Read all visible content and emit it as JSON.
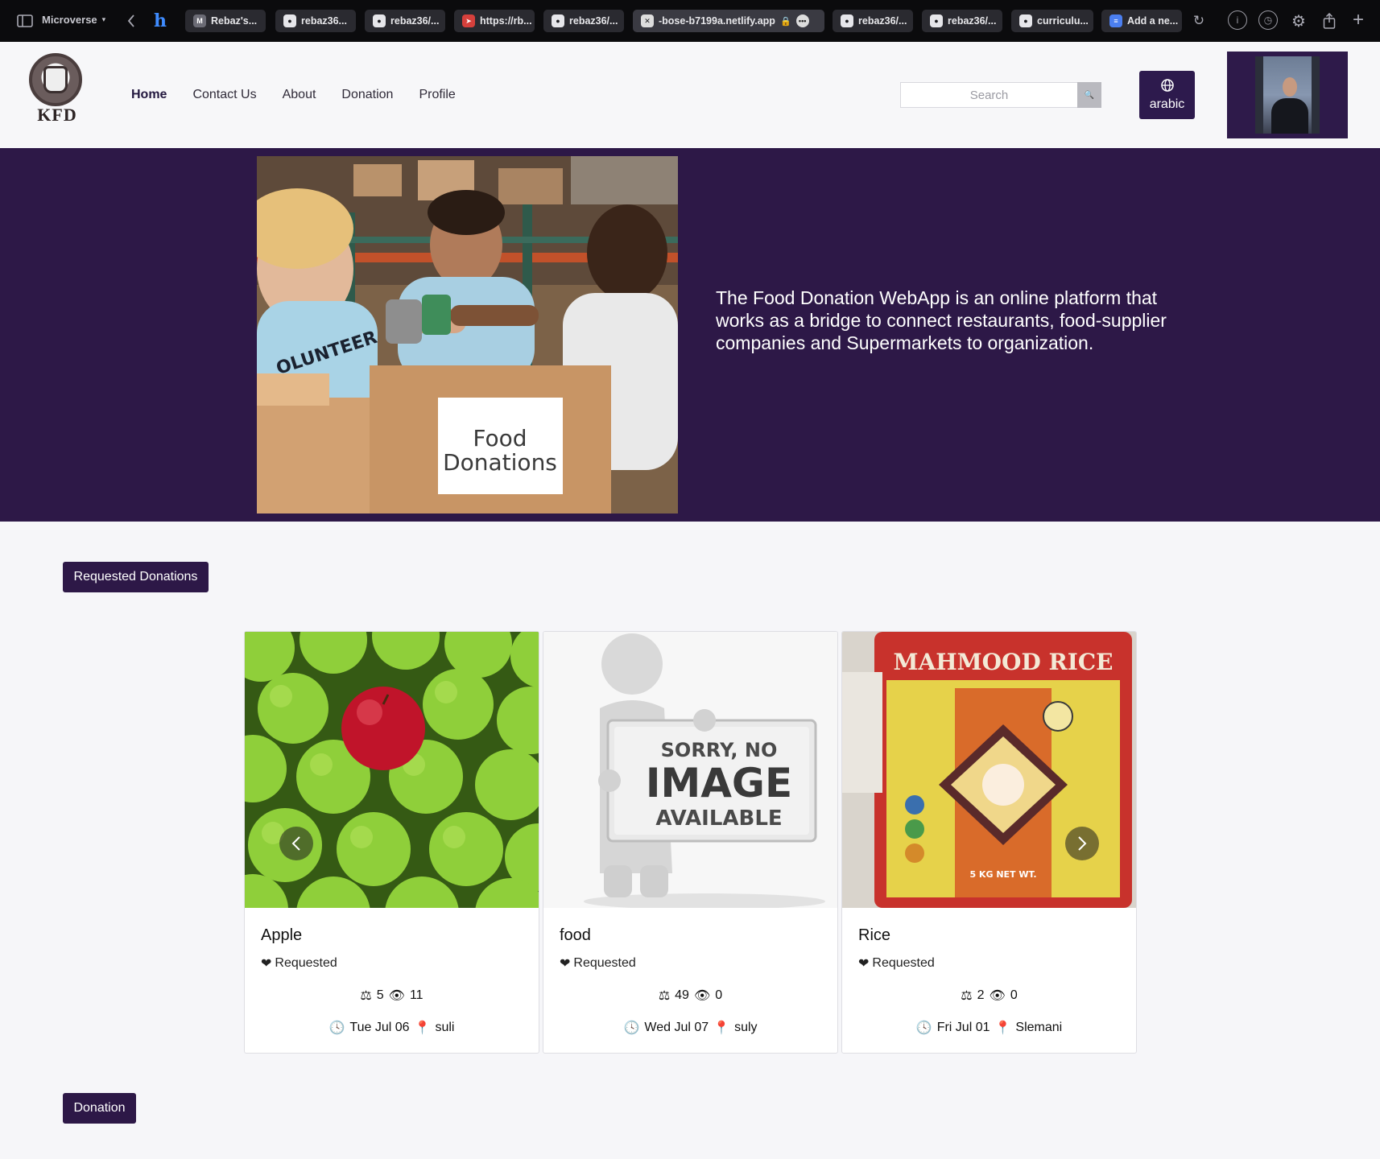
{
  "browser": {
    "workspace": "Microverse",
    "tabs": [
      {
        "label": "Rebaz's...",
        "favicon": "M"
      },
      {
        "label": "rebaz36...",
        "favicon": "github-icon"
      },
      {
        "label": "rebaz36/...",
        "favicon": "github-icon"
      },
      {
        "label": "https://rb...",
        "favicon": "rocket-icon"
      },
      {
        "label": "rebaz36/...",
        "favicon": "github-icon"
      },
      {
        "label": "-bose-b7199a.netlify.app",
        "favicon": "close-icon"
      },
      {
        "label": "rebaz36/...",
        "favicon": "github-icon"
      },
      {
        "label": "rebaz36/...",
        "favicon": "github-icon"
      },
      {
        "label": "curriculu...",
        "favicon": "github-icon"
      },
      {
        "label": "Add a ne...",
        "favicon": "docs-icon"
      }
    ]
  },
  "header": {
    "logo_text": "KFD",
    "nav": [
      "Home",
      "Contact Us",
      "About",
      "Donation",
      "Profile"
    ],
    "search_placeholder": "Search",
    "lang_label": "arabic"
  },
  "hero": {
    "sign_text_1": "Food",
    "sign_text_2": "Donations",
    "shirt_text": "OLUNTEER",
    "description": "The Food Donation WebApp is an online platform that works as a bridge to connect restaurants, food-supplier companies and Supermarkets to organization."
  },
  "sections": {
    "requested_label": "Requested Donations",
    "donation_label": "Donation"
  },
  "cards": [
    {
      "title": "Apple",
      "status": "Requested",
      "quantity": "5",
      "views": "11",
      "date": "Tue Jul 06",
      "location": "suli"
    },
    {
      "title": "food",
      "status": "Requested",
      "quantity": "49",
      "views": "0",
      "date": "Wed Jul 07",
      "location": "suly"
    },
    {
      "title": "Rice",
      "status": "Requested",
      "quantity": "2",
      "views": "0",
      "date": "Fri Jul 01",
      "location": "Slemani"
    }
  ],
  "placeholder_image": {
    "line1": "SORRY, NO",
    "line2": "IMAGE",
    "line3": "AVAILABLE"
  },
  "rice_bag": {
    "brand": "MAHMOOD RICE",
    "weight": "5 KG NET WT."
  },
  "colors": {
    "brand": "#2d1847",
    "chrome": "#0b0b0d"
  }
}
